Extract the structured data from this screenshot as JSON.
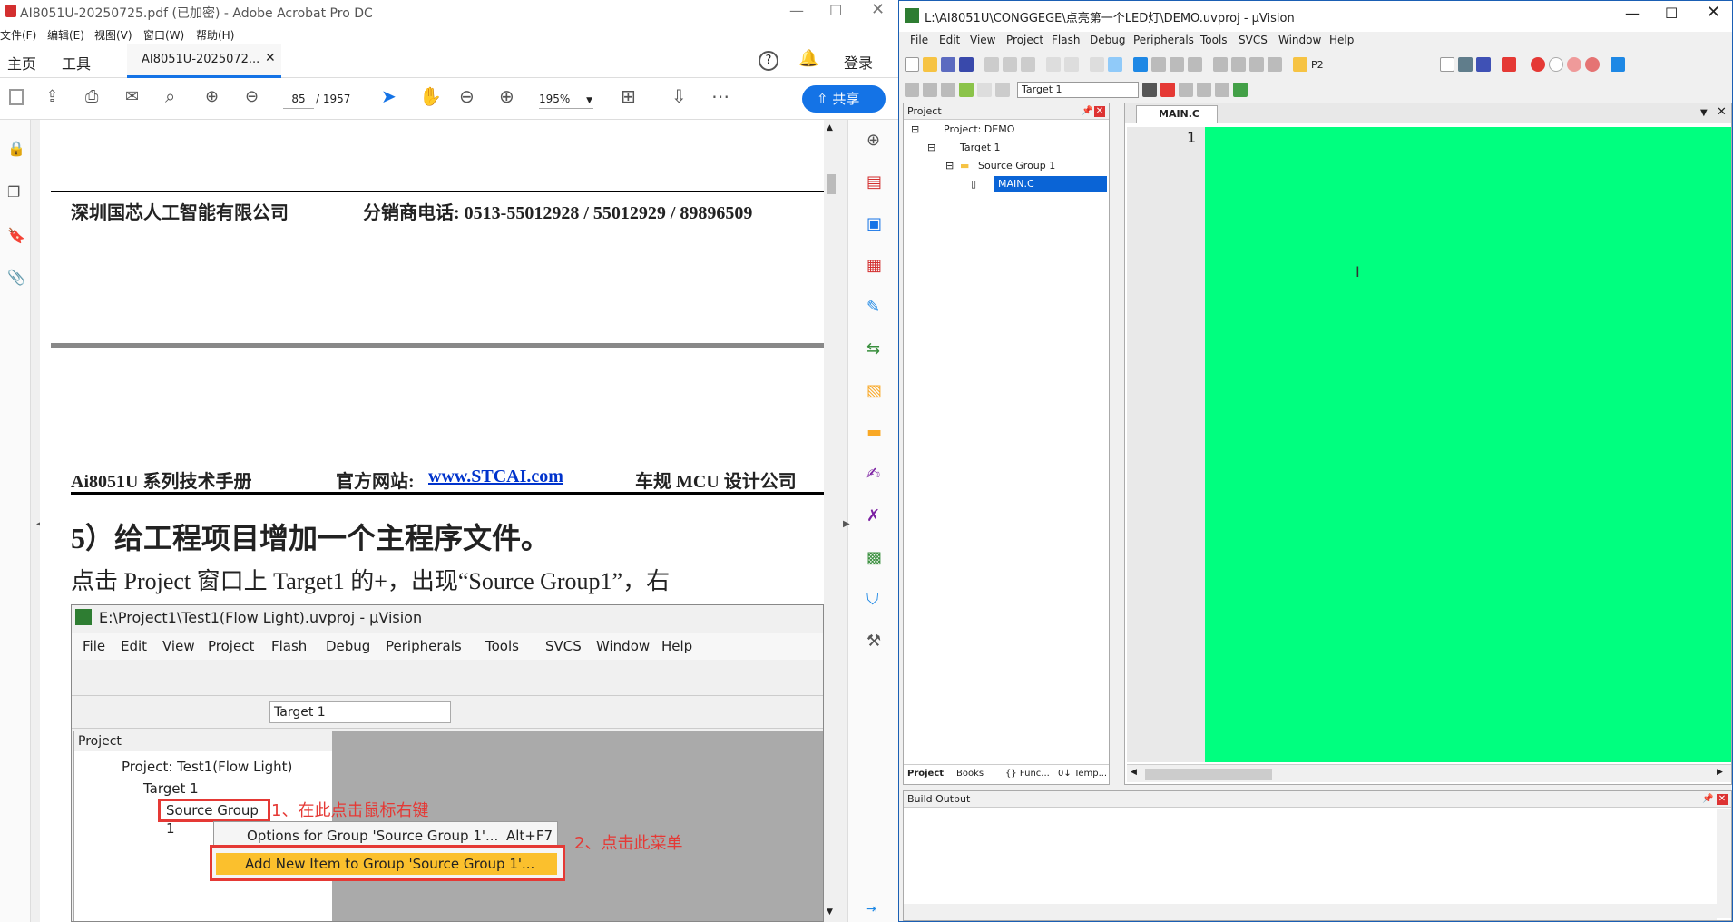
{
  "acrobat": {
    "title": "AI8051U-20250725.pdf (已加密) - Adobe Acrobat Pro DC",
    "menu": [
      "文件(F)",
      "编辑(E)",
      "视图(V)",
      "窗口(W)",
      "帮助(H)"
    ],
    "tabs": {
      "home": "主页",
      "tools": "工具",
      "doc": "AI8051U-2025072..."
    },
    "login": "登录",
    "page_current": "85",
    "page_total": "/ 1957",
    "zoom": "195%",
    "share": "共享"
  },
  "doc": {
    "footer_company": "深圳国芯人工智能有限公司",
    "footer_phone": "分销商电话: 0513-55012928 / 55012929 / 89896509",
    "header_manual": "Ai8051U 系列技术手册",
    "header_site_label": "官方网站:",
    "header_site": "www.STCAI.com",
    "header_slogan": "车规 MCU 设计公司",
    "heading": "5）给工程项目增加一个主程序文件。",
    "paragraph": "点击 Project 窗口上 Target1 的+，出现“Source Group1”，右",
    "embed": {
      "title": "E:\\Project1\\Test1(Flow Light).uvproj - µVision",
      "menu": [
        "File",
        "Edit",
        "View",
        "Project",
        "Flash",
        "Debug",
        "Peripherals",
        "Tools",
        "SVCS",
        "Window",
        "Help"
      ],
      "target": "Target 1",
      "panel": "Project",
      "tree": [
        "Project: Test1(Flow Light)",
        "Target 1",
        "Source Group 1"
      ],
      "annot1": "1、在此点击鼠标右键",
      "annot2": "2、点击此菜单",
      "ctx_item1": "Options for Group 'Source Group 1'...",
      "ctx_key1": "Alt+F7",
      "ctx_item2": "Add New  Item to Group 'Source Group 1'..."
    }
  },
  "uvision": {
    "title": "L:\\AI8051U\\CONGGEGE\\点亮第一个LED灯\\DEMO.uvproj - µVision",
    "menu": [
      "File",
      "Edit",
      "View",
      "Project",
      "Flash",
      "Debug",
      "Peripherals",
      "Tools",
      "SVCS",
      "Window",
      "Help"
    ],
    "toolbar_text": "P2",
    "target": "Target 1",
    "project_panel": "Project",
    "tree": [
      "Project: DEMO",
      "Target 1",
      "Source Group 1",
      "MAIN.C"
    ],
    "editor_tab": "MAIN.C",
    "line_number": "1",
    "bottom_tabs": [
      "Project",
      "Books",
      "{} Func...",
      "0↓ Temp..."
    ],
    "build_output": "Build Output",
    "editor_bg": "#00FF7F"
  }
}
